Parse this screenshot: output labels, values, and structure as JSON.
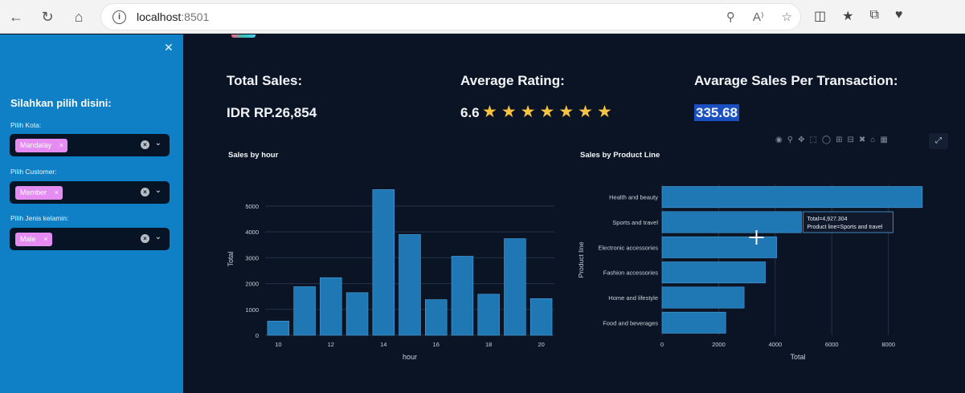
{
  "browser": {
    "url_host": "localhost",
    "url_port": ":8501"
  },
  "sidebar": {
    "title": "Silahkan pilih disini:",
    "filters": [
      {
        "label": "Pilih Kota:",
        "value": "Mandalay"
      },
      {
        "label": "Pilih Customer:",
        "value": "Member"
      },
      {
        "label": "Pilih Jenis kelamin:",
        "value": "Male"
      }
    ]
  },
  "metrics": {
    "total_sales_title": "Total Sales:",
    "total_sales_value": "IDR RP.26,854",
    "avg_rating_title": "Average Rating:",
    "avg_rating_value": "6.6",
    "avg_rating_stars": 7,
    "avg_sales_title": "Avarage Sales Per Transaction:",
    "avg_sales_value": "335.68"
  },
  "colors": {
    "bar": "#1f77b4",
    "sidebar": "#0f7fc6",
    "background": "#0b1424",
    "tag": "#e58cf2",
    "star": "#f6c343"
  },
  "chart_data": [
    {
      "type": "bar",
      "title": "Sales by hour",
      "xlabel": "hour",
      "ylabel": "Total",
      "x": [
        10,
        11,
        12,
        13,
        14,
        15,
        16,
        17,
        18,
        19,
        20
      ],
      "values": [
        550,
        1880,
        2230,
        1650,
        5640,
        3900,
        1380,
        3060,
        1590,
        3740,
        1420
      ],
      "xticks": [
        10,
        12,
        14,
        16,
        18,
        20
      ],
      "yticks": [
        0,
        1000,
        2000,
        3000,
        4000,
        5000
      ],
      "xlim": [
        9.5,
        20.5
      ],
      "ylim": [
        0,
        5900
      ],
      "grid": true
    },
    {
      "type": "bar",
      "orientation": "horizontal",
      "title": "Sales by Product Line",
      "xlabel": "Total",
      "ylabel": "Product line",
      "categories": [
        "Health and beauty",
        "Sports and travel",
        "Electronic accessories",
        "Fashion accessories",
        "Home and lifestyle",
        "Food and beverages"
      ],
      "values": [
        9200,
        4927.304,
        4050,
        3650,
        2900,
        2250
      ],
      "xticks": [
        0,
        2000,
        4000,
        6000,
        8000
      ],
      "xlim": [
        0,
        9600
      ],
      "grid": true,
      "tooltip": {
        "line1": "Total=4,927.304",
        "line2": "Product line=Sports and travel",
        "category_index": 1
      }
    }
  ]
}
